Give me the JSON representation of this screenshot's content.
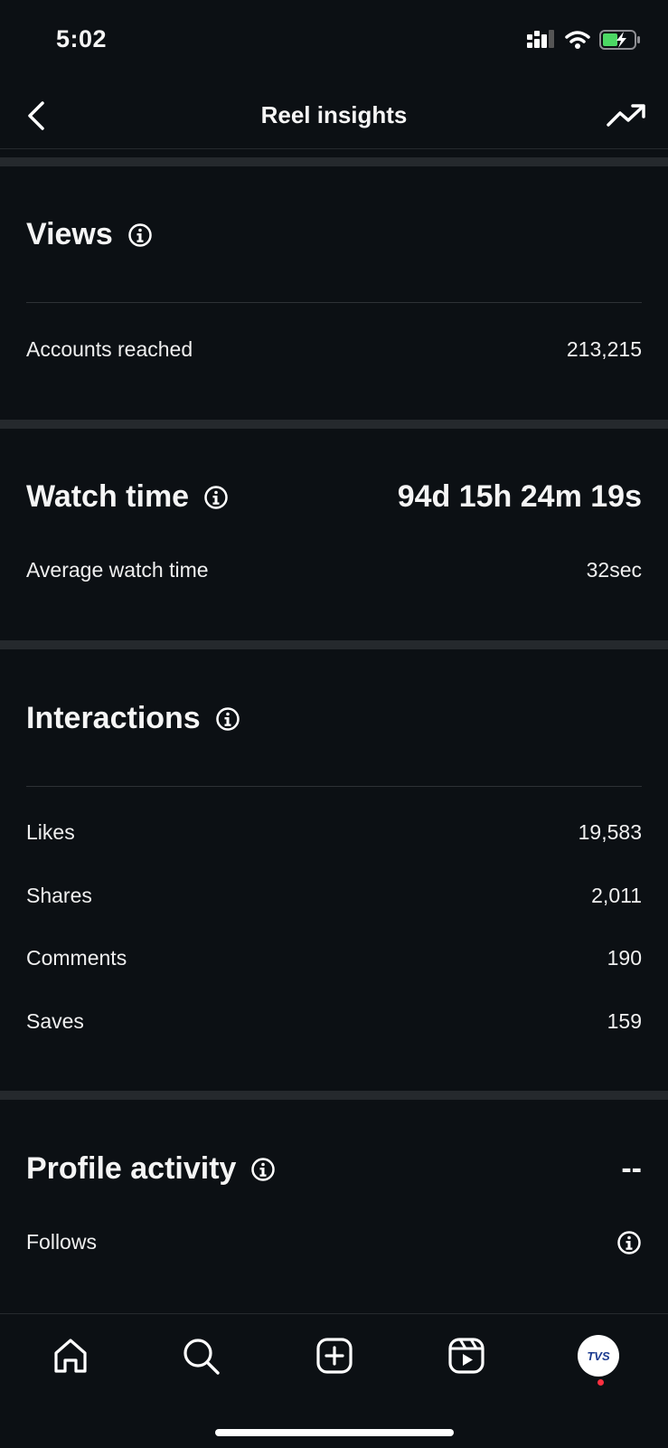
{
  "status_bar": {
    "time": "5:02"
  },
  "header": {
    "title": "Reel insights"
  },
  "views": {
    "title": "Views",
    "accounts_reached_label": "Accounts reached",
    "accounts_reached_value": "213,215"
  },
  "watch_time": {
    "title": "Watch time",
    "total": "94d 15h 24m 19s",
    "average_label": "Average watch time",
    "average_value": "32sec"
  },
  "interactions": {
    "title": "Interactions",
    "rows": [
      {
        "label": "Likes",
        "value": "19,583"
      },
      {
        "label": "Shares",
        "value": "2,011"
      },
      {
        "label": "Comments",
        "value": "190"
      },
      {
        "label": "Saves",
        "value": "159"
      }
    ]
  },
  "profile_activity": {
    "title": "Profile activity",
    "value": "--",
    "follows_label": "Follows"
  },
  "bottom_nav": {
    "items": [
      "home-icon",
      "search-icon",
      "create-icon",
      "reels-icon",
      "profile-avatar"
    ],
    "avatar_text": "TVS"
  },
  "colors": {
    "background": "#0c1014",
    "divider": "#25292d",
    "text": "#f5f5f5",
    "notification": "#ff3040",
    "battery": "#4cd964"
  }
}
